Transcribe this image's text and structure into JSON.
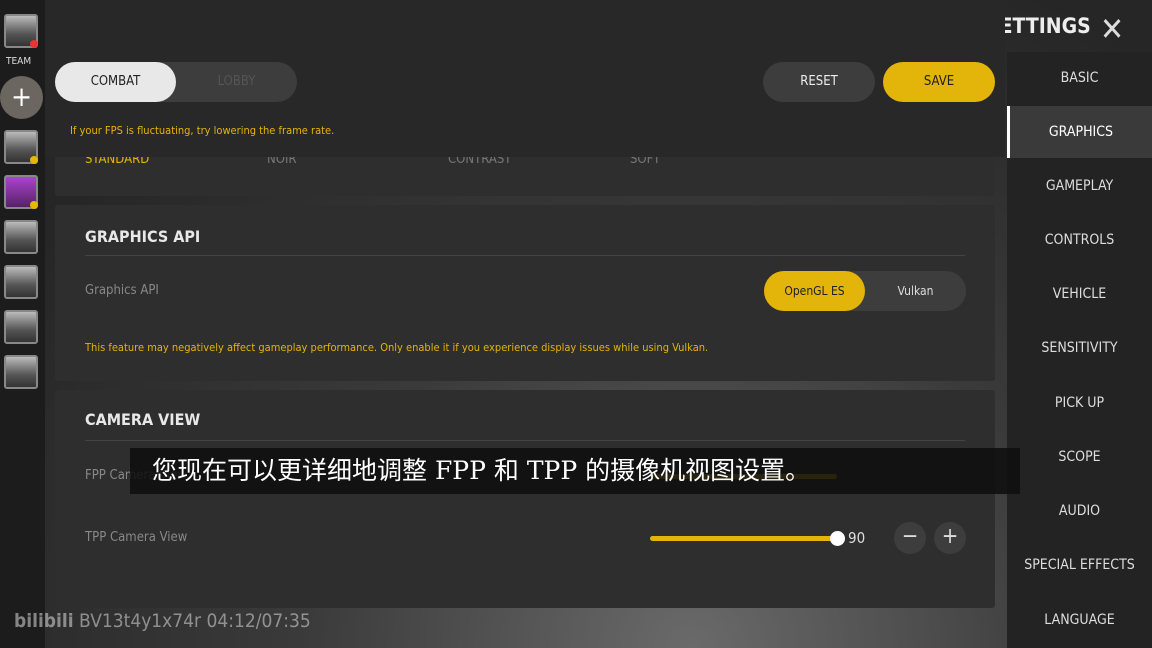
{
  "rail": {
    "team_label": "TEAM",
    "add": "+"
  },
  "header": {
    "tabs": [
      {
        "label": "COMBAT",
        "active": true
      },
      {
        "label": "LOBBY",
        "active": false
      }
    ],
    "reset": "RESET",
    "save": "SAVE",
    "tip": "If your FPS is fluctuating, try lowering the frame rate."
  },
  "filters": [
    "STANDARD",
    "NOIR",
    "CONTRAST",
    "SOFT"
  ],
  "graphics_api": {
    "title": "GRAPHICS API",
    "label": "Graphics API",
    "options": [
      "OpenGL ES",
      "Vulkan"
    ],
    "selected": "OpenGL ES",
    "warning": "This feature may negatively affect gameplay performance. Only enable it if you experience display issues while using Vulkan."
  },
  "camera": {
    "title": "CAMERA VIEW",
    "fpp_label": "FPP Camera View",
    "tpp_label": "TPP Camera View",
    "tpp_value": "90",
    "minus": "−",
    "plus": "+"
  },
  "settings": {
    "title": "SETTINGS",
    "close": "✕",
    "items": [
      "BASIC",
      "GRAPHICS",
      "GAMEPLAY",
      "CONTROLS",
      "VEHICLE",
      "SENSITIVITY",
      "PICK UP",
      "SCOPE",
      "AUDIO",
      "SPECIAL EFFECTS",
      "LANGUAGE"
    ],
    "selected": "GRAPHICS"
  },
  "subtitle": "您现在可以更详细地调整 FPP 和 TPP 的摄像机视图设置。",
  "watermark": {
    "logo": "bilibili",
    "text": "BV13t4y1x74r 04:12/07:35"
  },
  "colors": {
    "accent": "#e3b40a"
  }
}
